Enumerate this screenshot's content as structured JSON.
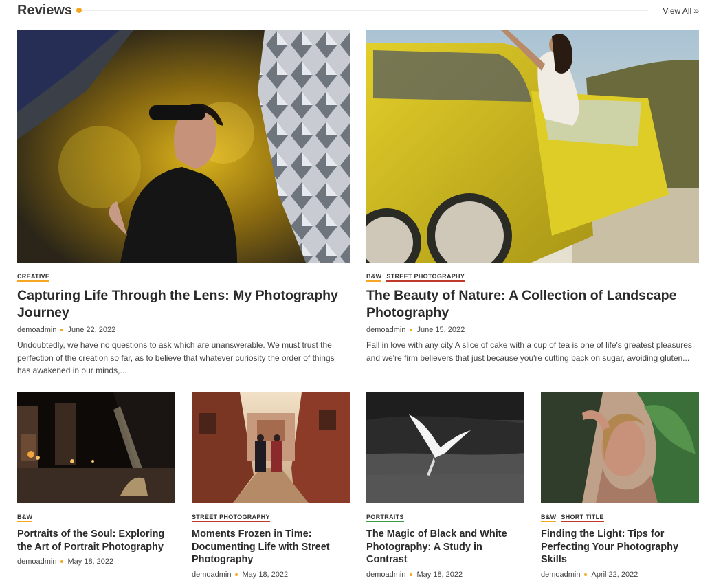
{
  "section": {
    "title": "Reviews",
    "view_all": "View All",
    "accent": "#f5a623"
  },
  "featured": [
    {
      "categories": [
        "CREATIVE"
      ],
      "title": "Capturing Life Through the Lens: My Photography Journey",
      "author": "demoadmin",
      "date": "June 22, 2022",
      "excerpt": "Undoubtedly, we have no questions to ask which are unanswerable. We must trust the perfection of the creation so far, as to believe that whatever curiosity the order of things has awakened in our minds,..."
    },
    {
      "categories": [
        "B&W",
        "STREET PHOTOGRAPHY"
      ],
      "title": "The Beauty of Nature: A Collection of Landscape Photography",
      "author": "demoadmin",
      "date": "June 15, 2022",
      "excerpt": "Fall in love with any city A slice of cake with a cup of tea is one of life's greatest pleasures, and we're firm believers that just because you're cutting back on sugar, avoiding gluten..."
    }
  ],
  "posts": [
    {
      "categories": [
        "B&W"
      ],
      "title": "Portraits of the Soul: Exploring the Art of Portrait Photography",
      "author": "demoadmin",
      "date": "May 18, 2022"
    },
    {
      "categories": [
        "STREET PHOTOGRAPHY"
      ],
      "title": "Moments Frozen in Time: Documenting Life with Street Photography",
      "author": "demoadmin",
      "date": "May 18, 2022"
    },
    {
      "categories": [
        "PORTRAITS"
      ],
      "title": "The Magic of Black and White Photography: A Study in Contrast",
      "author": "demoadmin",
      "date": "May 18, 2022"
    },
    {
      "categories": [
        "B&W",
        "SHORT TITLE"
      ],
      "title": "Finding the Light: Tips for Perfecting Your Photography Skills",
      "author": "demoadmin",
      "date": "April 22, 2022"
    }
  ]
}
